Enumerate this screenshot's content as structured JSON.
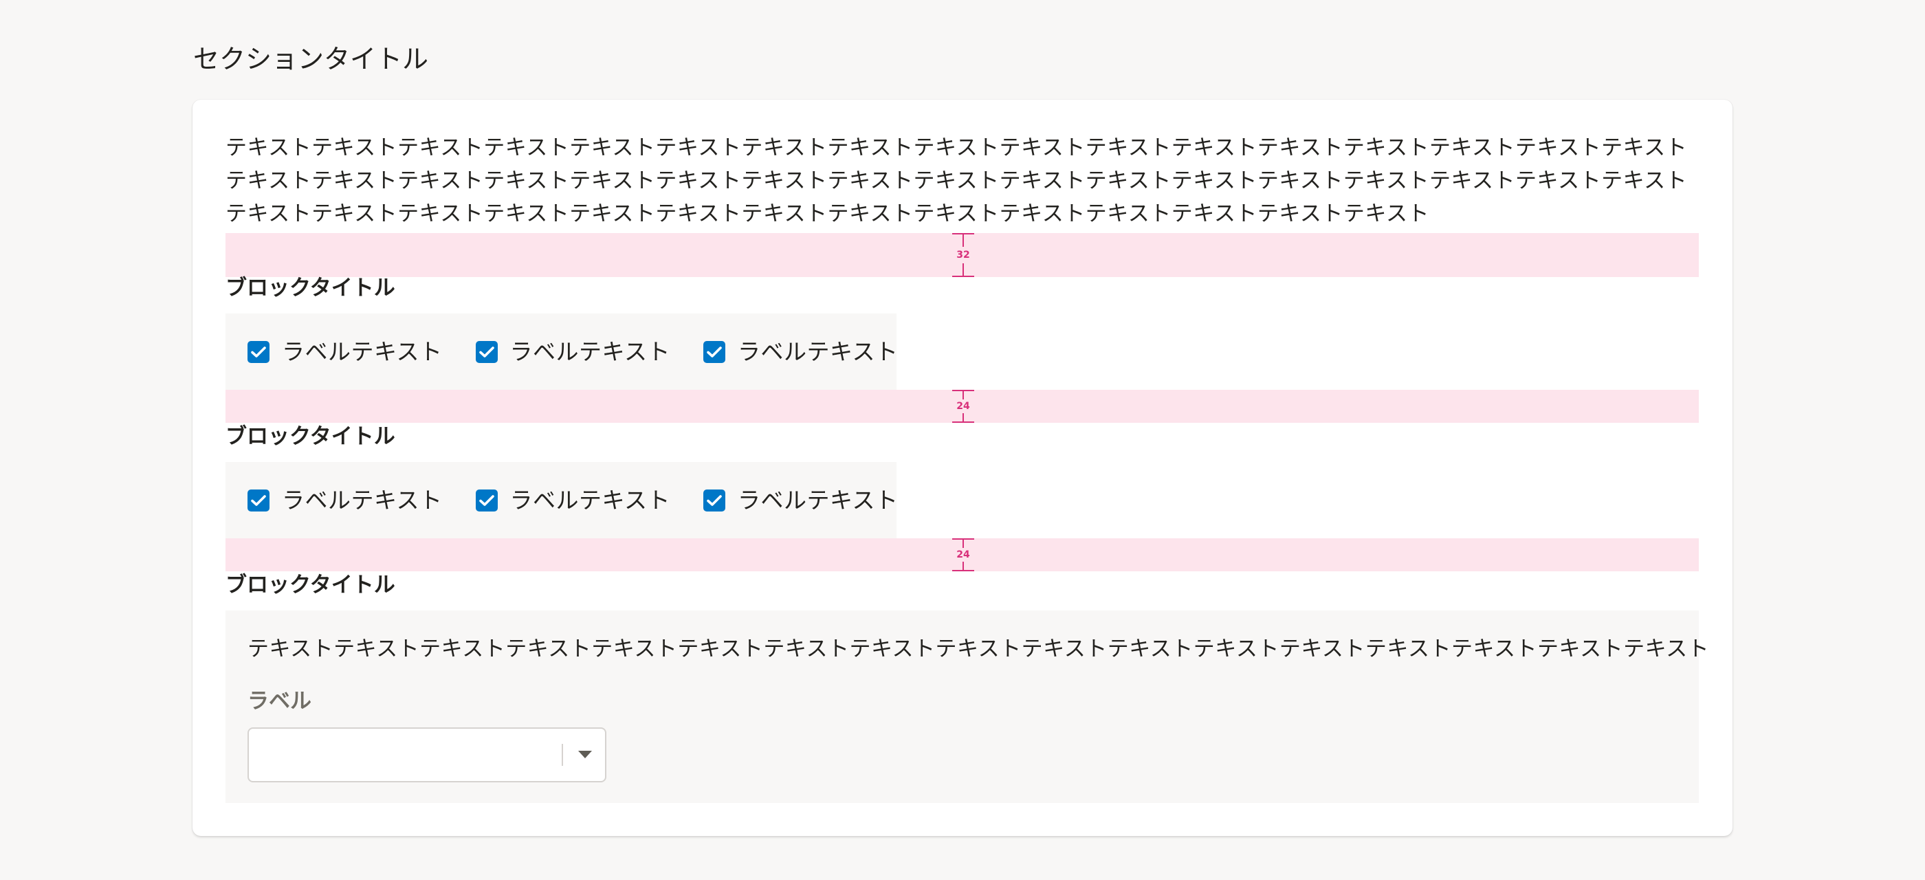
{
  "section": {
    "title": "セクションタイトル"
  },
  "intro_text": "テキストテキストテキストテキストテキストテキストテキストテキストテキストテキストテキストテキストテキストテキストテキストテキストテキストテキストテキストテキストテキストテキストテキストテキストテキストテキストテキストテキストテキストテキストテキストテキストテキストテキストテキストテキストテキストテキストテキストテキストテキストテキストテキストテキストテキストテキストテキストテキスト",
  "spacers": [
    {
      "value": "32"
    },
    {
      "value": "24"
    },
    {
      "value": "24"
    }
  ],
  "blocks": [
    {
      "title": "ブロックタイトル",
      "checkboxes": [
        {
          "label": "ラベルテキスト",
          "checked": true
        },
        {
          "label": "ラベルテキスト",
          "checked": true
        },
        {
          "label": "ラベルテキスト",
          "checked": true
        }
      ]
    },
    {
      "title": "ブロックタイトル",
      "checkboxes": [
        {
          "label": "ラベルテキスト",
          "checked": true
        },
        {
          "label": "ラベルテキスト",
          "checked": true
        },
        {
          "label": "ラベルテキスト",
          "checked": true
        }
      ]
    },
    {
      "title": "ブロックタイトル",
      "text": "テキストテキストテキストテキストテキストテキストテキストテキストテキストテキストテキストテキストテキストテキストテキストテキストテキスト",
      "field": {
        "label": "ラベル",
        "value": "",
        "icon": "chevron-down-icon"
      }
    }
  ],
  "colors": {
    "page_background": "#f8f7f6",
    "card_background": "#ffffff",
    "spacer_highlight": "#fde4ec",
    "spacer_marker": "#d8307a",
    "checkbox_checked": "#0077c7",
    "text_primary": "#23221f",
    "text_label": "#706d65"
  }
}
